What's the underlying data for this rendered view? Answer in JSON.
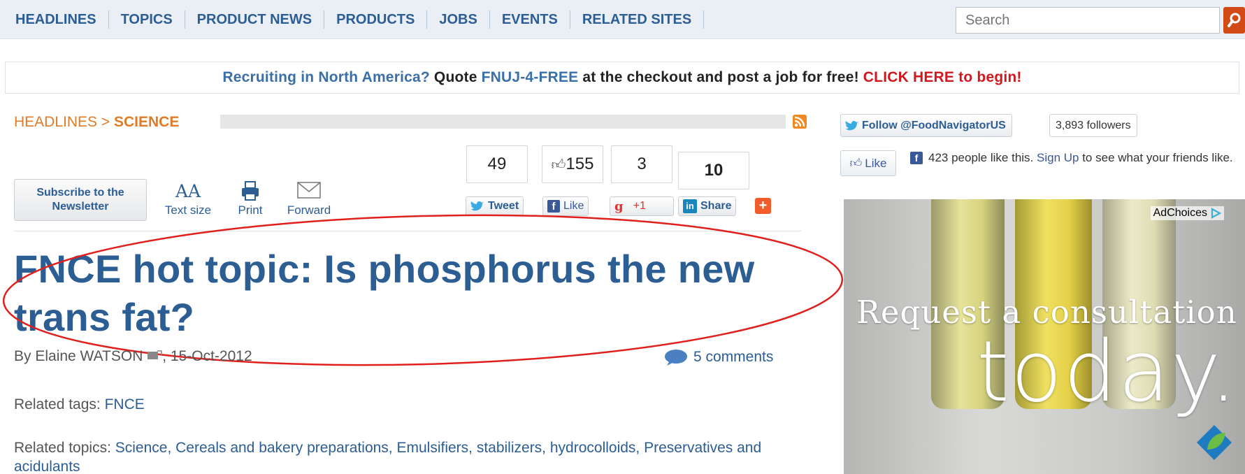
{
  "nav": {
    "items": [
      "HEADLINES",
      "TOPICS",
      "PRODUCT NEWS",
      "PRODUCTS",
      "JOBS",
      "EVENTS",
      "RELATED SITES"
    ],
    "search_placeholder": "Search"
  },
  "promo": {
    "part1": "Recruiting in North America?",
    "part2": " Quote ",
    "code": "FNUJ-4-FREE",
    "part3": " at the checkout and post a job for free! ",
    "cta": "CLICK HERE to begin!"
  },
  "breadcrumb": {
    "parent": "HEADLINES",
    "sep": " > ",
    "current": "SCIENCE"
  },
  "toolbar": {
    "subscribe_line1": "Subscribe to the",
    "subscribe_line2": "Newsletter",
    "textsize_icon": "AA",
    "textsize_label": "Text size",
    "print_label": "Print",
    "forward_label": "Forward"
  },
  "share": {
    "tweet_count": "49",
    "like_count": "155",
    "plus_count": "3",
    "linkedin_count": "10",
    "tweet_label": "Tweet",
    "like_label": "Like",
    "plus_label": "+1",
    "share_label": "Share"
  },
  "article": {
    "headline": "FNCE hot topic: Is phosphorus the new trans fat?",
    "byline_prefix": "By ",
    "author": "Elaine WATSON",
    "date": ", 15-Oct-2012",
    "comments": "5 comments",
    "tags_label": "Related tags: ",
    "tag": "FNCE",
    "topics_label": "Related topics: ",
    "topics": "Science, Cereals and bakery preparations, Emulsifiers, stabilizers, hydrocolloids, Preservatives and acidulants"
  },
  "sidebar": {
    "follow_label": "Follow @FoodNavigatorUS",
    "followers": "3,893 followers",
    "fb_like": "Like",
    "fb_text_1": "423 people like this. ",
    "fb_signup": "Sign Up",
    "fb_text_2": " to see what your friends like."
  },
  "ad": {
    "adchoices": "AdChoices",
    "line1": "Request a consultation",
    "line2": "today."
  },
  "colors": {
    "brand_blue": "#2c5d93",
    "accent_orange": "#e07b28",
    "cta_red": "#d1181f",
    "annotation_red": "#e0201c"
  },
  "icons": [
    "search-icon",
    "rss-icon",
    "print-icon",
    "mail-icon",
    "twitter-icon",
    "facebook-icon",
    "gplus-icon",
    "linkedin-icon",
    "addthis-icon",
    "comment-icon",
    "thumbs-up-icon",
    "adchoices-icon"
  ]
}
